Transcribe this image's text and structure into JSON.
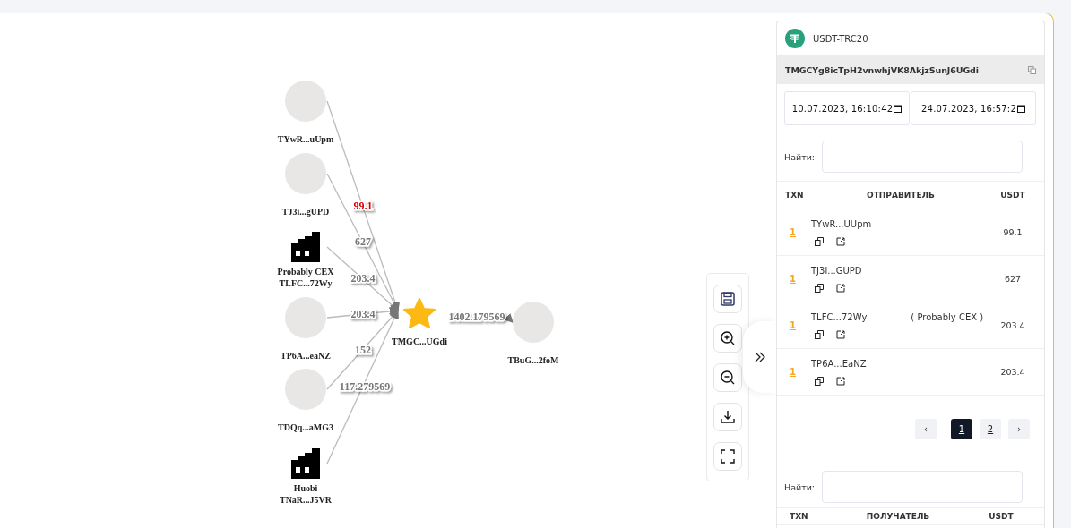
{
  "graph": {
    "nodes": [
      {
        "kind": "wallet",
        "lines": [
          "TYwR...uUpm"
        ]
      },
      {
        "kind": "wallet",
        "lines": [
          "TJ3i...gUPD"
        ]
      },
      {
        "kind": "exchange",
        "lines": [
          "Probably CEX",
          "TLFC...72Wy"
        ]
      },
      {
        "kind": "wallet",
        "lines": [
          "TP6A...eaNZ"
        ]
      },
      {
        "kind": "wallet",
        "lines": [
          "TDQq...aMG3"
        ]
      },
      {
        "kind": "exchange",
        "lines": [
          "Huobi",
          "TNaR...J5VR"
        ]
      },
      {
        "kind": "target",
        "lines": [
          "TMGC...UGdi"
        ]
      },
      {
        "kind": "wallet",
        "lines": [
          "TBuG...2foM"
        ]
      }
    ],
    "edges": [
      {
        "label": "99.1",
        "highlighted": true
      },
      {
        "label": "627",
        "highlighted": false
      },
      {
        "label": "203.4",
        "highlighted": false
      },
      {
        "label": "203.4",
        "highlighted": false
      },
      {
        "label": "152",
        "highlighted": false
      },
      {
        "label": "117.279569",
        "highlighted": false
      },
      {
        "label": "1402.179569",
        "highlighted": false
      }
    ]
  },
  "panel": {
    "token": "USDT-TRC20",
    "address": "TMGCYg8icTpH2vnwhjVK8AkjzSunJ6UGdi",
    "date_from": "10.07.2023, 16:10:42",
    "date_to": "24.07.2023, 16:57:2",
    "incoming": {
      "search_label": "Найти:",
      "columns": [
        "TXN",
        "ОТПРАВИТЕЛЬ",
        "USDT"
      ],
      "rows": [
        {
          "txn": "1",
          "address": "TYwR...UUpm",
          "amount": "99.1"
        },
        {
          "txn": "1",
          "address": "TJ3i...GUPD",
          "amount": "627"
        },
        {
          "txn": "1",
          "address": "TLFC...72Wy",
          "tag": "( Probably CEX )",
          "amount": "203.4"
        },
        {
          "txn": "1",
          "address": "TP6A...EaNZ",
          "amount": "203.4"
        }
      ],
      "pages": [
        {
          "label": "‹",
          "kind": "prev",
          "selected": false
        },
        {
          "label": "1",
          "kind": "page",
          "selected": true
        },
        {
          "label": "2",
          "kind": "page",
          "selected": false
        },
        {
          "label": "›",
          "kind": "next",
          "selected": false
        }
      ]
    },
    "outgoing": {
      "search_label": "Найти:",
      "columns": [
        "TXN",
        "ПОЛУЧАТЕЛЬ",
        "USDT"
      ]
    }
  }
}
